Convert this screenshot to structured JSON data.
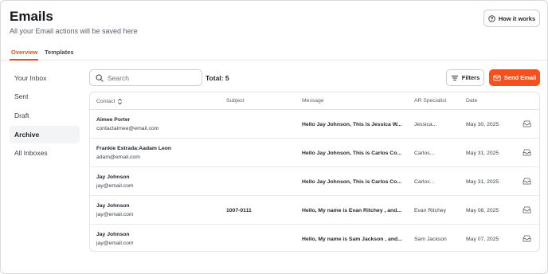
{
  "header": {
    "title": "Emails",
    "subtitle": "All your Email actions will be saved here",
    "how_it_works_label": "How it works"
  },
  "tabs": [
    {
      "label": "Overview",
      "active": true
    },
    {
      "label": "Templates",
      "active": false
    }
  ],
  "sidebar": {
    "items": [
      {
        "label": "Your Inbox",
        "active": false
      },
      {
        "label": "Sent",
        "active": false
      },
      {
        "label": "Draft",
        "active": false
      },
      {
        "label": "Archive",
        "active": true
      },
      {
        "label": "All Inboxes",
        "active": false
      }
    ]
  },
  "toolbar": {
    "search_placeholder": "Search",
    "total_label": "Total: 5",
    "filters_label": "Filters",
    "send_email_label": "Send Email"
  },
  "table": {
    "columns": [
      "Contact",
      "Subject",
      "Message",
      "AR Specialist",
      "Date"
    ],
    "rows": [
      {
        "name": "Aimee Porter",
        "email": "contactaimee@email.com",
        "subject": "",
        "message": "Hello Jay Johnson, This is Jessica W...",
        "specialist": "Jessica...",
        "date": "May 30, 2025"
      },
      {
        "name": "Frankie Estrada:Aadam Leon",
        "email": "adam@email.com",
        "subject": "",
        "message": "Hello Jay Johnson, This is Carlos Co...",
        "specialist": "Carlos...",
        "date": "May 31, 2025"
      },
      {
        "name": "Jay Johnson",
        "email": "jay@email.com",
        "subject": "",
        "message": "Hello Jay Johnson, This is Carlos Co...",
        "specialist": "Carlos...",
        "date": "May 31, 2025"
      },
      {
        "name": "Jay Johnson",
        "email": "jay@email.com",
        "subject": "1007-0111",
        "message": "Hello, My name is Evan Ritchey , and...",
        "specialist": "Evan Ritchey",
        "date": "May 08, 2025"
      },
      {
        "name": "Jay Johnson",
        "email": "jay@email.com",
        "subject": "",
        "message": "Hello, My name is Sam Jackson , and...",
        "specialist": "Sam Jackson",
        "date": "May 07, 2025"
      }
    ]
  },
  "icons": {
    "help": "help-circle-icon",
    "search": "search-icon",
    "filters": "filter-lines-icon",
    "send": "mail-icon",
    "sort": "sort-icon",
    "row_action": "inbox-icon"
  },
  "colors": {
    "accent": "#f4511e",
    "tab_active": "#e8501d"
  }
}
